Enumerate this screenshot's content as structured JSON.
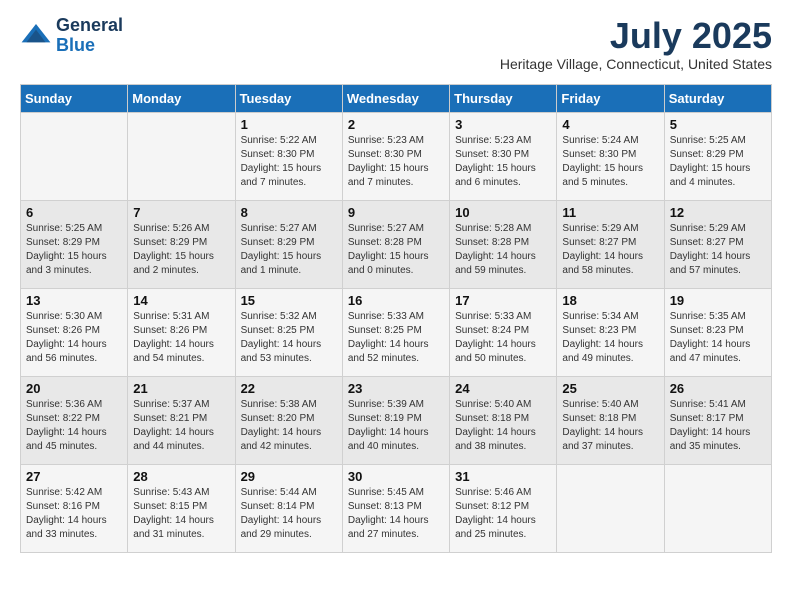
{
  "header": {
    "logo_general": "General",
    "logo_blue": "Blue",
    "month_title": "July 2025",
    "location": "Heritage Village, Connecticut, United States"
  },
  "days_of_week": [
    "Sunday",
    "Monday",
    "Tuesday",
    "Wednesday",
    "Thursday",
    "Friday",
    "Saturday"
  ],
  "weeks": [
    [
      {
        "day": "",
        "info": ""
      },
      {
        "day": "",
        "info": ""
      },
      {
        "day": "1",
        "info": "Sunrise: 5:22 AM\nSunset: 8:30 PM\nDaylight: 15 hours and 7 minutes."
      },
      {
        "day": "2",
        "info": "Sunrise: 5:23 AM\nSunset: 8:30 PM\nDaylight: 15 hours and 7 minutes."
      },
      {
        "day": "3",
        "info": "Sunrise: 5:23 AM\nSunset: 8:30 PM\nDaylight: 15 hours and 6 minutes."
      },
      {
        "day": "4",
        "info": "Sunrise: 5:24 AM\nSunset: 8:30 PM\nDaylight: 15 hours and 5 minutes."
      },
      {
        "day": "5",
        "info": "Sunrise: 5:25 AM\nSunset: 8:29 PM\nDaylight: 15 hours and 4 minutes."
      }
    ],
    [
      {
        "day": "6",
        "info": "Sunrise: 5:25 AM\nSunset: 8:29 PM\nDaylight: 15 hours and 3 minutes."
      },
      {
        "day": "7",
        "info": "Sunrise: 5:26 AM\nSunset: 8:29 PM\nDaylight: 15 hours and 2 minutes."
      },
      {
        "day": "8",
        "info": "Sunrise: 5:27 AM\nSunset: 8:29 PM\nDaylight: 15 hours and 1 minute."
      },
      {
        "day": "9",
        "info": "Sunrise: 5:27 AM\nSunset: 8:28 PM\nDaylight: 15 hours and 0 minutes."
      },
      {
        "day": "10",
        "info": "Sunrise: 5:28 AM\nSunset: 8:28 PM\nDaylight: 14 hours and 59 minutes."
      },
      {
        "day": "11",
        "info": "Sunrise: 5:29 AM\nSunset: 8:27 PM\nDaylight: 14 hours and 58 minutes."
      },
      {
        "day": "12",
        "info": "Sunrise: 5:29 AM\nSunset: 8:27 PM\nDaylight: 14 hours and 57 minutes."
      }
    ],
    [
      {
        "day": "13",
        "info": "Sunrise: 5:30 AM\nSunset: 8:26 PM\nDaylight: 14 hours and 56 minutes."
      },
      {
        "day": "14",
        "info": "Sunrise: 5:31 AM\nSunset: 8:26 PM\nDaylight: 14 hours and 54 minutes."
      },
      {
        "day": "15",
        "info": "Sunrise: 5:32 AM\nSunset: 8:25 PM\nDaylight: 14 hours and 53 minutes."
      },
      {
        "day": "16",
        "info": "Sunrise: 5:33 AM\nSunset: 8:25 PM\nDaylight: 14 hours and 52 minutes."
      },
      {
        "day": "17",
        "info": "Sunrise: 5:33 AM\nSunset: 8:24 PM\nDaylight: 14 hours and 50 minutes."
      },
      {
        "day": "18",
        "info": "Sunrise: 5:34 AM\nSunset: 8:23 PM\nDaylight: 14 hours and 49 minutes."
      },
      {
        "day": "19",
        "info": "Sunrise: 5:35 AM\nSunset: 8:23 PM\nDaylight: 14 hours and 47 minutes."
      }
    ],
    [
      {
        "day": "20",
        "info": "Sunrise: 5:36 AM\nSunset: 8:22 PM\nDaylight: 14 hours and 45 minutes."
      },
      {
        "day": "21",
        "info": "Sunrise: 5:37 AM\nSunset: 8:21 PM\nDaylight: 14 hours and 44 minutes."
      },
      {
        "day": "22",
        "info": "Sunrise: 5:38 AM\nSunset: 8:20 PM\nDaylight: 14 hours and 42 minutes."
      },
      {
        "day": "23",
        "info": "Sunrise: 5:39 AM\nSunset: 8:19 PM\nDaylight: 14 hours and 40 minutes."
      },
      {
        "day": "24",
        "info": "Sunrise: 5:40 AM\nSunset: 8:18 PM\nDaylight: 14 hours and 38 minutes."
      },
      {
        "day": "25",
        "info": "Sunrise: 5:40 AM\nSunset: 8:18 PM\nDaylight: 14 hours and 37 minutes."
      },
      {
        "day": "26",
        "info": "Sunrise: 5:41 AM\nSunset: 8:17 PM\nDaylight: 14 hours and 35 minutes."
      }
    ],
    [
      {
        "day": "27",
        "info": "Sunrise: 5:42 AM\nSunset: 8:16 PM\nDaylight: 14 hours and 33 minutes."
      },
      {
        "day": "28",
        "info": "Sunrise: 5:43 AM\nSunset: 8:15 PM\nDaylight: 14 hours and 31 minutes."
      },
      {
        "day": "29",
        "info": "Sunrise: 5:44 AM\nSunset: 8:14 PM\nDaylight: 14 hours and 29 minutes."
      },
      {
        "day": "30",
        "info": "Sunrise: 5:45 AM\nSunset: 8:13 PM\nDaylight: 14 hours and 27 minutes."
      },
      {
        "day": "31",
        "info": "Sunrise: 5:46 AM\nSunset: 8:12 PM\nDaylight: 14 hours and 25 minutes."
      },
      {
        "day": "",
        "info": ""
      },
      {
        "day": "",
        "info": ""
      }
    ]
  ]
}
